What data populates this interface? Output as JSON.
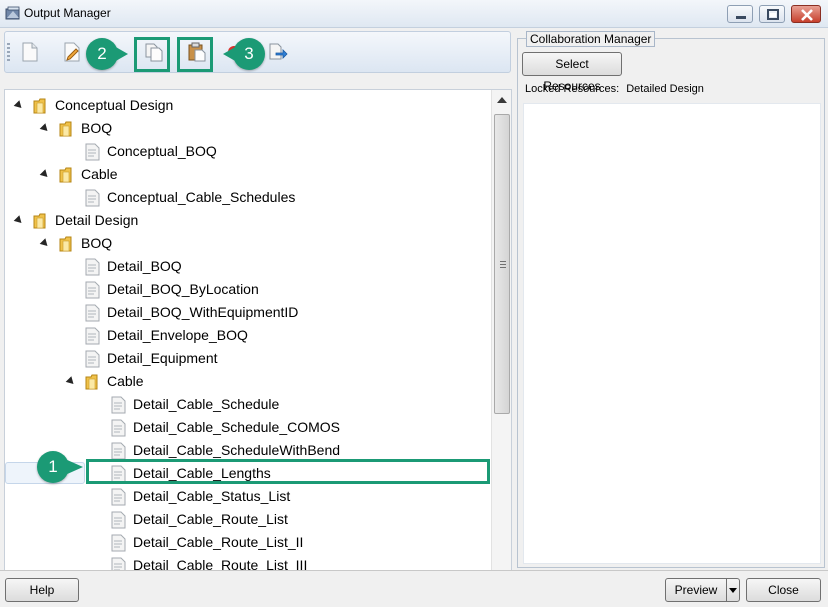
{
  "window": {
    "title": "Output Manager",
    "minimize_icon": "minimize-icon",
    "maximize_icon": "maximize-icon",
    "close_icon": "close-icon"
  },
  "toolbar": {
    "buttons": [
      {
        "icon": "new-document-icon"
      },
      {
        "icon": "edit-document-icon"
      },
      {
        "icon": "copy-icon"
      },
      {
        "icon": "paste-icon"
      },
      {
        "icon": "delete-icon"
      },
      {
        "icon": "export-icon"
      }
    ]
  },
  "tree": {
    "items": [
      {
        "label": "Conceptual Design",
        "type": "folder",
        "level": 0,
        "expanded": true
      },
      {
        "label": "BOQ",
        "type": "folder",
        "level": 1,
        "expanded": true
      },
      {
        "label": "Conceptual_BOQ",
        "type": "report",
        "level": 2
      },
      {
        "label": "Cable",
        "type": "folder",
        "level": 1,
        "expanded": true
      },
      {
        "label": "Conceptual_Cable_Schedules",
        "type": "report",
        "level": 2
      },
      {
        "label": "Detail Design",
        "type": "folder",
        "level": 0,
        "expanded": true
      },
      {
        "label": "BOQ",
        "type": "folder",
        "level": 1,
        "expanded": true
      },
      {
        "label": "Detail_BOQ",
        "type": "report",
        "level": 2
      },
      {
        "label": "Detail_BOQ_ByLocation",
        "type": "report",
        "level": 2
      },
      {
        "label": "Detail_BOQ_WithEquipmentID",
        "type": "report",
        "level": 2
      },
      {
        "label": "Detail_Envelope_BOQ",
        "type": "report",
        "level": 2
      },
      {
        "label": "Detail_Equipment",
        "type": "report",
        "level": 2
      },
      {
        "label": "Cable",
        "type": "folder",
        "level": 2,
        "expanded": true
      },
      {
        "label": "Detail_Cable_Schedule",
        "type": "report",
        "level": 3
      },
      {
        "label": "Detail_Cable_Schedule_COMOS",
        "type": "report",
        "level": 3
      },
      {
        "label": "Detail_Cable_ScheduleWithBend",
        "type": "report",
        "level": 3
      },
      {
        "label": "Detail_Cable_Lengths",
        "type": "report",
        "level": 3,
        "selected": true
      },
      {
        "label": "Detail_Cable_Status_List",
        "type": "report",
        "level": 3
      },
      {
        "label": "Detail_Cable_Route_List",
        "type": "report",
        "level": 3
      },
      {
        "label": "Detail_Cable_Route_List_II",
        "type": "report",
        "level": 3
      },
      {
        "label": "Detail_Cable_Route_List_III",
        "type": "report",
        "level": 3
      }
    ]
  },
  "collaboration": {
    "title": "Collaboration Manager",
    "select_resources_label": "Select Resources",
    "locked_label": "Locked Resources:",
    "locked_value": "Detailed Design"
  },
  "bottom": {
    "help_label": "Help",
    "preview_label": "Preview",
    "close_label": "Close"
  },
  "callouts": [
    {
      "number": "1"
    },
    {
      "number": "2"
    },
    {
      "number": "3"
    }
  ],
  "colors": {
    "callout": "#1b9a75",
    "toolbar_bg": "#dce6f2"
  }
}
